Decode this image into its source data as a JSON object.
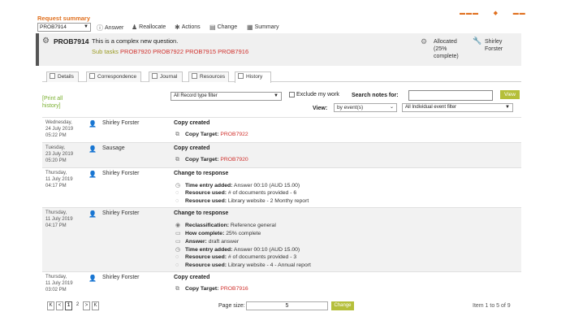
{
  "header": {
    "title": "Request summary",
    "selected_request": "PROB7914",
    "toolbar": [
      {
        "label": "Answer",
        "icon": "info-icon"
      },
      {
        "label": "Reallocate",
        "icon": "reallocate-icon"
      },
      {
        "label": "Actions",
        "icon": "actions-icon"
      },
      {
        "label": "Change",
        "icon": "change-icon"
      },
      {
        "label": "Summary",
        "icon": "summary-icon"
      }
    ]
  },
  "request": {
    "number": "PROB7914",
    "description": "This is a complex new question.",
    "subtasks_label": "Sub tasks",
    "subtasks": [
      "PROB7920",
      "PROB7922",
      "PROB7915",
      "PROB7916"
    ],
    "status": "Allocated (25% complete)",
    "assignee": "Shirley Forster"
  },
  "tabs": [
    {
      "label": "Details"
    },
    {
      "label": "Correspondence"
    },
    {
      "label": "Journal"
    },
    {
      "label": "Resources"
    },
    {
      "label": "History"
    }
  ],
  "filters": {
    "print_all": "[Print all history]",
    "record_type_filter": "All Record type filter",
    "exclude_my_work": "Exclude my work",
    "search_label": "Search notes for:",
    "search_value": "",
    "view_button": "View",
    "view_label": "View:",
    "view_mode": "by event(s)",
    "individual_event_filter": "All Individual event filter"
  },
  "history": [
    {
      "date": [
        "Wednesday,",
        "24 July 2019",
        "05:22 PM"
      ],
      "user": "Shirley Forster",
      "title": "Copy created",
      "lines": [
        {
          "key": "Copy Target:",
          "val": "",
          "link": "PROB7922"
        }
      ]
    },
    {
      "date": [
        "Tuesday,",
        "23 July 2019",
        "05:20 PM"
      ],
      "user": "Sausage",
      "title": "Copy created",
      "lines": [
        {
          "key": "Copy Target:",
          "val": "",
          "link": "PROB7920"
        }
      ]
    },
    {
      "date": [
        "Thursday,",
        "11 July 2019",
        "04:17 PM"
      ],
      "user": "Shirley Forster",
      "title": "Change to response",
      "lines": [
        {
          "key": "Time entry added:",
          "val": " Answer 00:10 (AUD 15.00)"
        },
        {
          "key": "Resource used:",
          "val": " # of documents provided - 6"
        },
        {
          "key": "Resource used:",
          "val": " Library website - 2 Monthy report"
        }
      ]
    },
    {
      "date": [
        "Thursday,",
        "11 July 2019",
        "04:17 PM"
      ],
      "user": "Shirley Forster",
      "title": "Change to response",
      "lines": [
        {
          "key": "Reclassification:",
          "val": " Reference general"
        },
        {
          "key": "How complete:",
          "val": " 25% complete"
        },
        {
          "key": "Answer:",
          "val": " draft answer"
        },
        {
          "key": "Time entry added:",
          "val": " Answer 00:10 (AUD 15.00)"
        },
        {
          "key": "Resource used:",
          "val": " # of documents provided - 3"
        },
        {
          "key": "Resource used:",
          "val": " Library website - 4 - Annual report"
        }
      ]
    },
    {
      "date": [
        "Thursday,",
        "11 July 2019",
        "03:02 PM"
      ],
      "user": "Shirley Forster",
      "title": "Copy created",
      "lines": [
        {
          "key": "Copy Target:",
          "val": "",
          "link": "PROB7916"
        }
      ]
    }
  ],
  "pager": {
    "first": "K",
    "prev": "<",
    "pages": [
      "1",
      "2"
    ],
    "next": ">",
    "last": "K",
    "page_size_label": "Page size:",
    "page_size": "5",
    "change_button": "Change",
    "item_count": "Item 1 to 5 of 9"
  },
  "colors": {
    "accent_orange": "#e0701f",
    "link_red": "#d0312d",
    "button_olive": "#b5bf3a",
    "print_green": "#7ab030"
  }
}
